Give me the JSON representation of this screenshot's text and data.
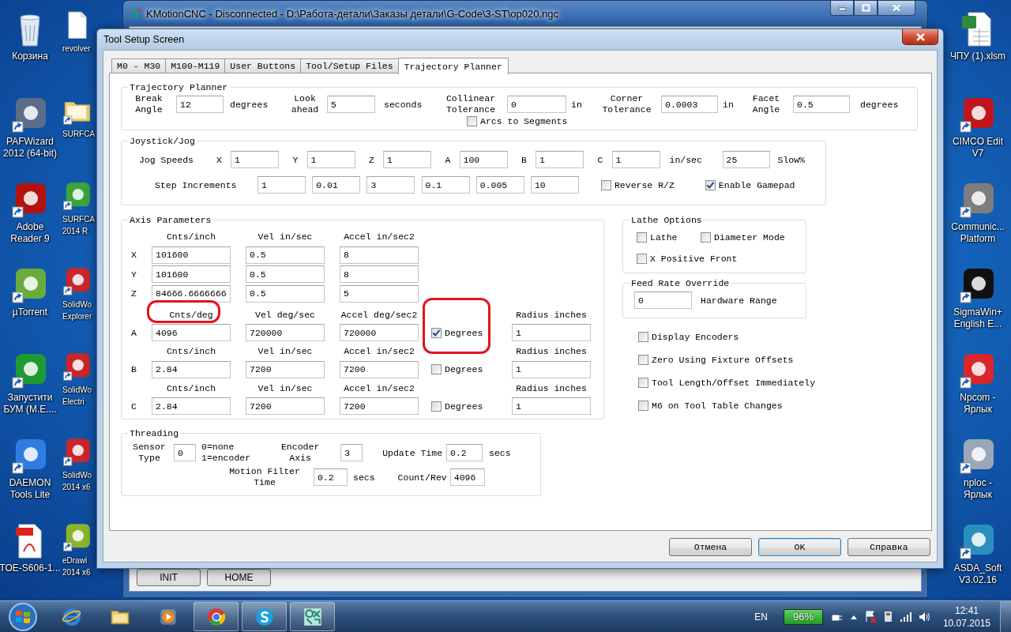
{
  "desktop": {
    "left_icons": [
      {
        "label": "Корзина",
        "kind": "recycle-bin",
        "shortcut": false
      },
      {
        "label": "PAFWizard\n2012 (64-bit)",
        "kind": "app",
        "color": "#5a6e8c",
        "shortcut": true
      },
      {
        "label": "Adobe\nReader 9",
        "kind": "app",
        "color": "#b3120e",
        "shortcut": true
      },
      {
        "label": "µTorrent",
        "kind": "app",
        "color": "#6aac3c",
        "shortcut": true
      },
      {
        "label": "Запустити\nБУМ (М.Е....",
        "kind": "app",
        "color": "#1f9a33",
        "shortcut": true
      },
      {
        "label": "DAEMON\nTools Lite",
        "kind": "app",
        "color": "#2f7de0",
        "shortcut": true
      },
      {
        "label": "TOE-S606-1...",
        "kind": "pdf",
        "shortcut": false
      }
    ],
    "second_column_icons": [
      {
        "label": "revolver",
        "kind": "document",
        "shortcut": false
      },
      {
        "label": "SURFCA",
        "kind": "folder",
        "shortcut": true
      },
      {
        "label": "SURFCA\n2014 R",
        "kind": "app",
        "color": "#3aa53a",
        "shortcut": true
      },
      {
        "label": "SolidWo\nExplorer",
        "kind": "app",
        "color": "#c8262a",
        "shortcut": true
      },
      {
        "label": "SolidWo\nElectri",
        "kind": "app",
        "color": "#c8262a",
        "shortcut": true
      },
      {
        "label": "SolidWo\n2014 x6",
        "kind": "app",
        "color": "#c8262a",
        "shortcut": true
      },
      {
        "label": "eDrawi\n2014 x6",
        "kind": "app",
        "color": "#8ab52e",
        "shortcut": true
      }
    ],
    "right_icons": [
      {
        "label": "ЧПУ (1).xlsm",
        "kind": "spreadsheet",
        "shortcut": false
      },
      {
        "label": "CIMCO Edit\nV7",
        "kind": "app",
        "color": "#c0151b",
        "shortcut": true
      },
      {
        "label": "Communic...\nPlatform",
        "kind": "app",
        "color": "#7d7d7d",
        "shortcut": true
      },
      {
        "label": "SigmaWin+\nEnglish E...",
        "kind": "app",
        "color": "#111111",
        "shortcut": true
      },
      {
        "label": "Npcom -\nЯрлык",
        "kind": "app",
        "color": "#d8262a",
        "shortcut": true
      },
      {
        "label": "nploc -\nЯрлык",
        "kind": "app",
        "color": "#9aa7b8",
        "shortcut": true
      },
      {
        "label": "ASDA_Soft\nV3.02.16",
        "kind": "app",
        "color": "#2a8fbf",
        "shortcut": true
      }
    ]
  },
  "main_window": {
    "title": "KMotionCNC - Disconnected - D:\\Работа-детали\\Заказы детали\\G-Code\\3-ST\\op020.ngc",
    "buttons": [
      "INIT",
      "HOME"
    ]
  },
  "dialog": {
    "title": "Tool Setup Screen",
    "tabs": [
      {
        "label": "M0 - M30",
        "selected": false
      },
      {
        "label": "M100-M119",
        "selected": false
      },
      {
        "label": "User Buttons",
        "selected": false
      },
      {
        "label": "Tool/Setup Files",
        "selected": false
      },
      {
        "label": "Trajectory Planner",
        "selected": true
      }
    ],
    "trajectory_planner": {
      "title": "Trajectory Planner",
      "fields": [
        {
          "label": "Break Angle",
          "value": "12",
          "unit": "degrees"
        },
        {
          "label": "Look ahead",
          "value": "5",
          "unit": "seconds"
        },
        {
          "label": "Collinear Tolerance",
          "value": "0",
          "unit": "in"
        },
        {
          "label": "Corner Tolerance",
          "value": "0.0003",
          "unit": "in"
        },
        {
          "label": "Facet Angle",
          "value": "0.5",
          "unit": "degrees"
        }
      ],
      "arcs_to_segments": {
        "label": "Arcs to Segments",
        "checked": false
      }
    },
    "joystick_jog": {
      "title": "Joystick/Jog",
      "jog_speeds": {
        "label": "Jog Speeds",
        "axes": [
          {
            "axis": "X",
            "value": "1"
          },
          {
            "axis": "Y",
            "value": "1"
          },
          {
            "axis": "Z",
            "value": "1"
          },
          {
            "axis": "A",
            "value": "100"
          },
          {
            "axis": "B",
            "value": "1"
          },
          {
            "axis": "C",
            "value": "1"
          }
        ],
        "unit": "in/sec",
        "slow_value": "25",
        "slow_label": "Slow%"
      },
      "step_increments": {
        "label": "Step Increments",
        "values": [
          "1",
          "0.01",
          "3",
          "0.1",
          "0.005",
          "10"
        ]
      },
      "checks": [
        {
          "label": "Reverse R/Z",
          "checked": false
        },
        {
          "label": "Enable Gamepad",
          "checked": true
        }
      ]
    },
    "axis_parameters": {
      "title": "Axis Parameters",
      "blocks": [
        {
          "headers": [
            {
              "text": "Cnts/inch",
              "highlighted": false
            },
            {
              "text": "Vel in/sec",
              "highlighted": false
            },
            {
              "text": "Accel in/sec2",
              "highlighted": false
            }
          ],
          "rows": [
            {
              "axis": "X",
              "values": [
                "101600",
                "0.5",
                "8"
              ]
            },
            {
              "axis": "Y",
              "values": [
                "101600",
                "0.5",
                "8"
              ]
            },
            {
              "axis": "Z",
              "values": [
                "84666.6666666",
                "0.5",
                "5"
              ]
            }
          ]
        },
        {
          "headers": [
            {
              "text": "Cnts/deg",
              "highlighted": true
            },
            {
              "text": "Vel deg/sec",
              "highlighted": false
            },
            {
              "text": "Accel deg/sec2",
              "highlighted": false
            },
            {
              "text": "Radius inches",
              "highlighted": false
            }
          ],
          "rows": [
            {
              "axis": "A",
              "values": [
                "4096",
                "720000",
                "720000"
              ],
              "degrees": {
                "label": "Degrees",
                "checked": true,
                "highlighted": true
              },
              "radius": "1"
            }
          ]
        },
        {
          "headers": [
            {
              "text": "Cnts/inch",
              "highlighted": false
            },
            {
              "text": "Vel in/sec",
              "highlighted": false
            },
            {
              "text": "Accel in/sec2",
              "highlighted": false
            },
            {
              "text": "Radius inches",
              "highlighted": false
            }
          ],
          "rows": [
            {
              "axis": "B",
              "values": [
                "2.84",
                "7200",
                "7200"
              ],
              "degrees": {
                "label": "Degrees",
                "checked": false,
                "highlighted": false
              },
              "radius": "1"
            }
          ]
        },
        {
          "headers": [
            {
              "text": "Cnts/inch",
              "highlighted": false
            },
            {
              "text": "Vel in/sec",
              "highlighted": false
            },
            {
              "text": "Accel in/sec2",
              "highlighted": false
            },
            {
              "text": "Radius inches",
              "highlighted": false
            }
          ],
          "rows": [
            {
              "axis": "C",
              "values": [
                "2.84",
                "7200",
                "7200"
              ],
              "degrees": {
                "label": "Degrees",
                "checked": false,
                "highlighted": false
              },
              "radius": "1"
            }
          ]
        }
      ]
    },
    "lathe_options": {
      "title": "Lathe Options",
      "checks": [
        {
          "label": "Lathe",
          "checked": false
        },
        {
          "label": "Diameter Mode",
          "checked": false
        },
        {
          "label": "X Positive Front",
          "checked": false
        }
      ]
    },
    "feed_rate_override": {
      "title": "Feed Rate Override",
      "value": "0",
      "label": "Hardware Range"
    },
    "options": [
      {
        "label": "Display Encoders",
        "checked": false
      },
      {
        "label": "Zero Using Fixture Offsets",
        "checked": false
      },
      {
        "label": "Tool Length/Offset Immediately",
        "checked": false
      },
      {
        "label": "M6 on Tool Table Changes",
        "checked": false
      }
    ],
    "threading": {
      "title": "Threading",
      "fields": [
        {
          "label": "Sensor Type",
          "value": "0",
          "note": "0=none\n1=encoder"
        },
        {
          "label": "Encoder Axis",
          "value": "3"
        },
        {
          "label": "Update Time",
          "value": "0.2",
          "unit": "secs"
        },
        {
          "label": "Motion Filter Time",
          "value": "0.2",
          "unit": "secs"
        },
        {
          "label": "Count/Rev",
          "value": "4096"
        }
      ]
    },
    "buttons": [
      {
        "label": "Отмена",
        "default": false
      },
      {
        "label": "OK",
        "default": true
      },
      {
        "label": "Справка",
        "default": false
      }
    ]
  },
  "taskbar": {
    "pinned": [
      {
        "kind": "browser",
        "running": false
      },
      {
        "kind": "folder",
        "running": false
      },
      {
        "kind": "media",
        "running": false
      },
      {
        "kind": "round-logo",
        "running": true
      },
      {
        "kind": "chat",
        "running": true
      },
      {
        "kind": "cnc-app",
        "running": true
      }
    ],
    "language": "EN",
    "battery": "96%",
    "time": "12:41",
    "date": "10.07.2015"
  }
}
